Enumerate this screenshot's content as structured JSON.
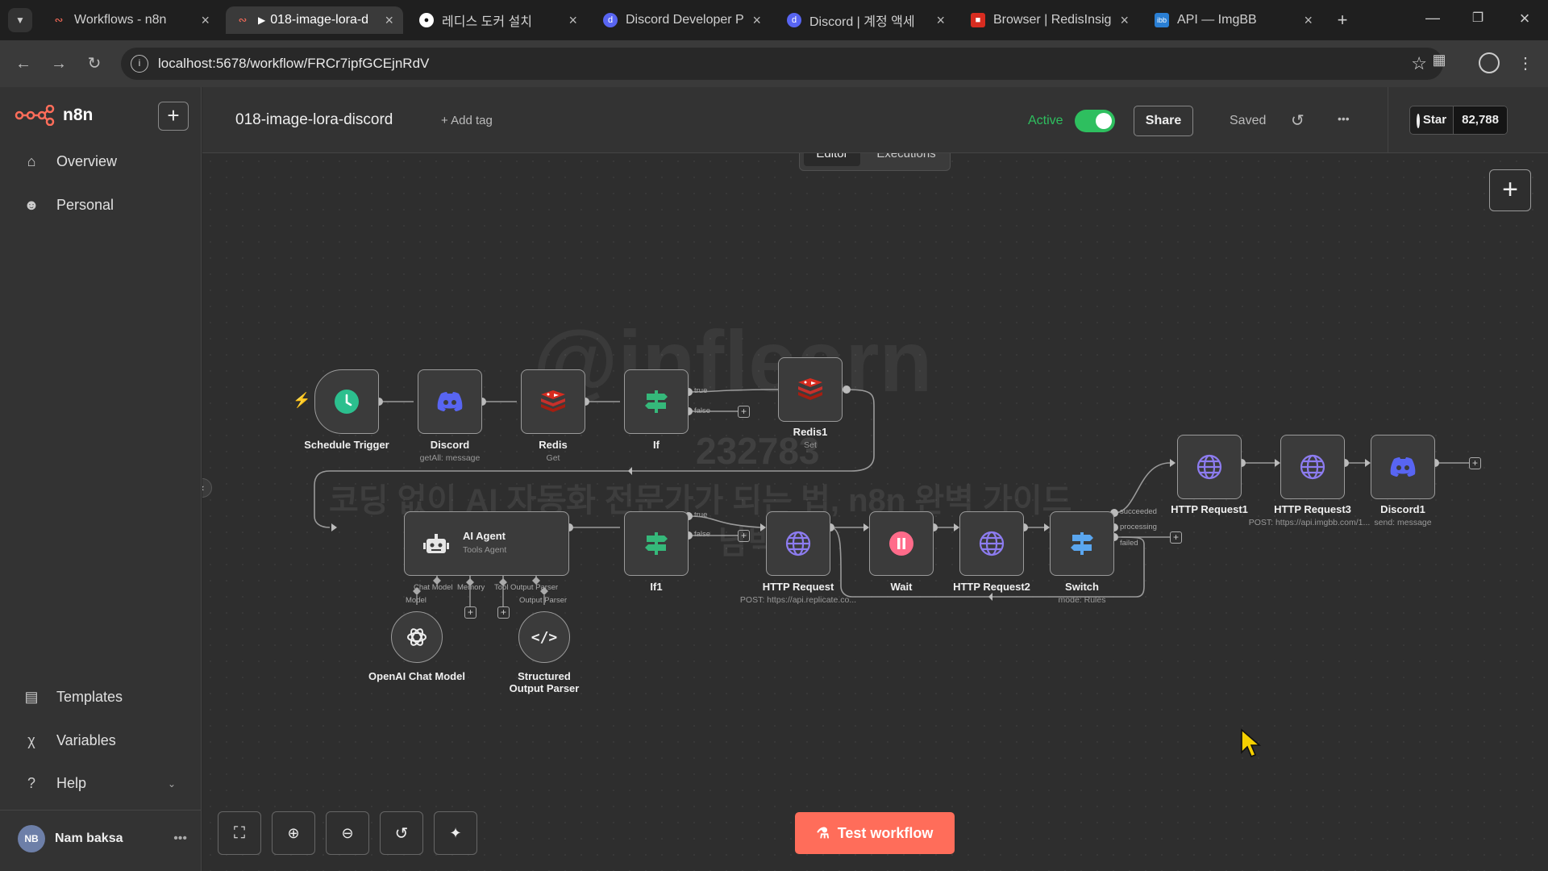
{
  "browser": {
    "tabs": [
      {
        "title": "Workflows - n8n",
        "icon": "n8n-icon",
        "active": false
      },
      {
        "title": "018-image-lora-d",
        "icon": "n8n-icon",
        "active": true
      },
      {
        "title": "레디스 도커 설치",
        "icon": "github-icon",
        "active": false
      },
      {
        "title": "Discord Developer P",
        "icon": "discord-icon",
        "active": false
      },
      {
        "title": "Discord | 계정 액세",
        "icon": "discord-icon",
        "active": false
      },
      {
        "title": "Browser | RedisInsig",
        "icon": "redis-icon",
        "active": false
      },
      {
        "title": "API — ImgBB",
        "icon": "imgbb-icon",
        "active": false
      }
    ],
    "url": "localhost:5678/workflow/FRCr7ipfGCEjnRdV"
  },
  "sidebar": {
    "logo": "n8n",
    "items": [
      {
        "label": "Overview",
        "icon": "home-icon"
      },
      {
        "label": "Personal",
        "icon": "user-icon"
      }
    ],
    "bottom_items": [
      {
        "label": "Templates",
        "icon": "templates-icon"
      },
      {
        "label": "Variables",
        "icon": "variables-icon"
      },
      {
        "label": "Help",
        "icon": "help-icon"
      }
    ],
    "user": {
      "initials": "NB",
      "name": "Nam baksa"
    }
  },
  "header": {
    "workflow_name": "018-image-lora-discord",
    "add_tag": "+ Add tag",
    "active_label": "Active",
    "active": true,
    "share": "Share",
    "saved": "Saved",
    "star": "Star",
    "star_count": "82,788",
    "tabs": [
      {
        "label": "Editor",
        "active": true
      },
      {
        "label": "Executions",
        "active": false
      }
    ]
  },
  "nodes": [
    {
      "name": "Schedule Trigger",
      "sub": "",
      "icon": "clock-icon"
    },
    {
      "name": "Discord",
      "sub": "getAll: message",
      "icon": "discord-icon"
    },
    {
      "name": "Redis",
      "sub": "Get",
      "icon": "redis-icon"
    },
    {
      "name": "If",
      "sub": "",
      "icon": "if-icon"
    },
    {
      "name": "Redis1",
      "sub": "Set",
      "icon": "redis-icon"
    },
    {
      "name": "AI Agent",
      "sub": "Tools Agent",
      "icon": "robot-icon"
    },
    {
      "name": "If1",
      "sub": "",
      "icon": "if-icon"
    },
    {
      "name": "HTTP Request",
      "sub": "POST: https://api.replicate.co...",
      "icon": "globe-icon"
    },
    {
      "name": "Wait",
      "sub": "",
      "icon": "pause-icon"
    },
    {
      "name": "HTTP Request2",
      "sub": "",
      "icon": "globe-icon"
    },
    {
      "name": "Switch",
      "sub": "mode: Rules",
      "icon": "switch-icon"
    },
    {
      "name": "HTTP Request1",
      "sub": "",
      "icon": "globe-icon"
    },
    {
      "name": "HTTP Request3",
      "sub": "POST: https://api.imgbb.com/1...",
      "icon": "globe-icon"
    },
    {
      "name": "Discord1",
      "sub": "send: message",
      "icon": "discord-icon"
    },
    {
      "name": "OpenAI Chat Model",
      "sub": "",
      "icon": "openai-icon"
    },
    {
      "name": "Structured Output Parser",
      "sub": "",
      "icon": "code-icon"
    }
  ],
  "ports": {
    "true": "true",
    "false": "false",
    "chat_model": "Chat Model",
    "model": "Model",
    "memory": "Memory",
    "tool": "Tool",
    "output_parser": "Output Parser",
    "succeeded": "succeeded",
    "processing": "processing",
    "failed": "failed"
  },
  "watermark": {
    "number": "232783",
    "text": "코딩 없이 AI 자동화 전문가가 되는 법, n8n 완벽 가이드",
    "name": "남박사"
  },
  "footer": {
    "test_workflow": "Test workflow",
    "controls": [
      {
        "icon": "fit-view-icon"
      },
      {
        "icon": "zoom-in-icon"
      },
      {
        "icon": "zoom-out-icon"
      },
      {
        "icon": "reset-zoom-icon"
      },
      {
        "icon": "tidy-up-icon"
      }
    ]
  },
  "colors": {
    "accent": "#ff6d5a",
    "active_green": "#2ebf5f",
    "discord": "#5865f2",
    "redis": "#d82c20",
    "if_green": "#35b87a",
    "switch_blue": "#5aa6ef",
    "wait_pink": "#ff6b8a",
    "globe_purple": "#8d7cf0"
  }
}
